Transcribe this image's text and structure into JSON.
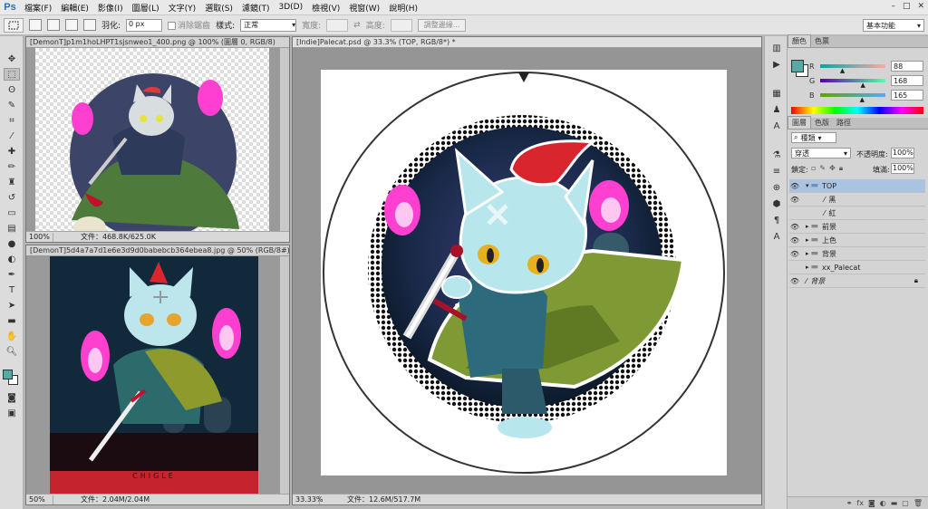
{
  "app": {
    "logo": "Ps"
  },
  "menu": [
    "檔案(F)",
    "編輯(E)",
    "影像(I)",
    "圖層(L)",
    "文字(Y)",
    "選取(S)",
    "濾鏡(T)",
    "3D(D)",
    "檢視(V)",
    "視窗(W)",
    "說明(H)"
  ],
  "window_controls": [
    "–",
    "□",
    "✕"
  ],
  "options": {
    "feather_label": "羽化:",
    "feather_value": "0 px",
    "antialias_label": "消除鋸齒",
    "style_label": "樣式:",
    "style_value": "正常",
    "width_label": "寬度:",
    "height_label": "高度:",
    "refine_edge_label": "調整邊緣...",
    "workspace": "基本功能"
  },
  "documents": [
    {
      "title": "[DemonT]p1m1hoLHPT1sjsnweo1_400.png @ 100% (圖層 0, RGB/8)",
      "zoom": "100%",
      "info": "文件：468.8K/625.0K"
    },
    {
      "title": "[DemonT]5d4a7a7d1e6e3d9d0babebcb364ebea8.jpg @ 50% (RGB/8#)",
      "zoom": "50%",
      "info": "文件：2.04M/2.04M",
      "signature": "CHIGLE"
    },
    {
      "title": "[Indie]Palecat.psd @ 33.3% (TOP, RGB/8*) *",
      "zoom": "33.33%",
      "info": "文件：12.6M/517.7M"
    }
  ],
  "color_panel": {
    "tabs": [
      "顏色",
      "色票"
    ],
    "r": "88",
    "g": "168",
    "b": "165",
    "r_level": 0.345,
    "g_level": 0.659,
    "b_level": 0.647,
    "fg_color": "#58a8a5"
  },
  "layers_panel": {
    "tabs": [
      "圖層",
      "色版",
      "路徑"
    ],
    "filter_kind": "種類",
    "blend_mode": "穿透",
    "opacity_label": "不透明度:",
    "opacity_value": "100%",
    "lock_label": "鎖定:",
    "fill_label": "填滿:",
    "fill_value": "100%",
    "layers": [
      {
        "name": "TOP",
        "kind": "group",
        "expanded": true,
        "selected": true,
        "visible": true,
        "indent": 0
      },
      {
        "name": "黑",
        "kind": "layer",
        "visible": true,
        "indent": 1
      },
      {
        "name": "紅",
        "kind": "layer",
        "visible": false,
        "indent": 1
      },
      {
        "name": "前景",
        "kind": "group",
        "visible": true,
        "indent": 0
      },
      {
        "name": "上色",
        "kind": "group",
        "visible": true,
        "indent": 0
      },
      {
        "name": "背景",
        "kind": "group",
        "visible": true,
        "indent": 0
      },
      {
        "name": "xx_Palecat",
        "kind": "group",
        "visible": false,
        "indent": 0
      },
      {
        "name": "背景",
        "kind": "background",
        "visible": true,
        "indent": 0,
        "italic": true
      }
    ]
  },
  "colors": {
    "accent_pink": "#ff3fd0",
    "cape_green": "#7f9a34",
    "cat_body": "#b7e6ec",
    "hat_red": "#d9262e",
    "selection_blue": "#a9c3e0"
  }
}
